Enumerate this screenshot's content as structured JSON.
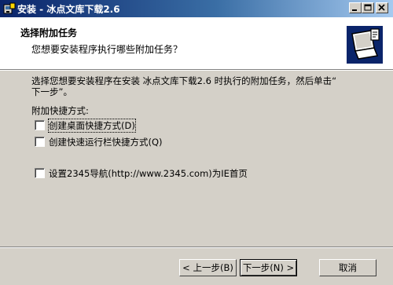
{
  "window": {
    "title": "安装 - 冰点文库下载2.6"
  },
  "header": {
    "title": "选择附加任务",
    "subtitle": "您想要安装程序执行哪些附加任务？"
  },
  "main": {
    "intro_line1": "选择您想要安装程序在安装 冰点文库下载2.6 时执行的附加任务，然后单击“",
    "intro_line2": "下一步”。",
    "shortcuts_label": "附加快捷方式:",
    "checkboxes": [
      {
        "label": "创建桌面快捷方式(D)",
        "checked": false
      },
      {
        "label": "创建快速运行栏快捷方式(Q)",
        "checked": false
      },
      {
        "label": "设置2345导航(http://www.2345.com)为IE首页",
        "checked": false
      }
    ]
  },
  "buttons": {
    "back": "< 上一步(B)",
    "next": "下一步(N) >",
    "cancel": "取消"
  }
}
